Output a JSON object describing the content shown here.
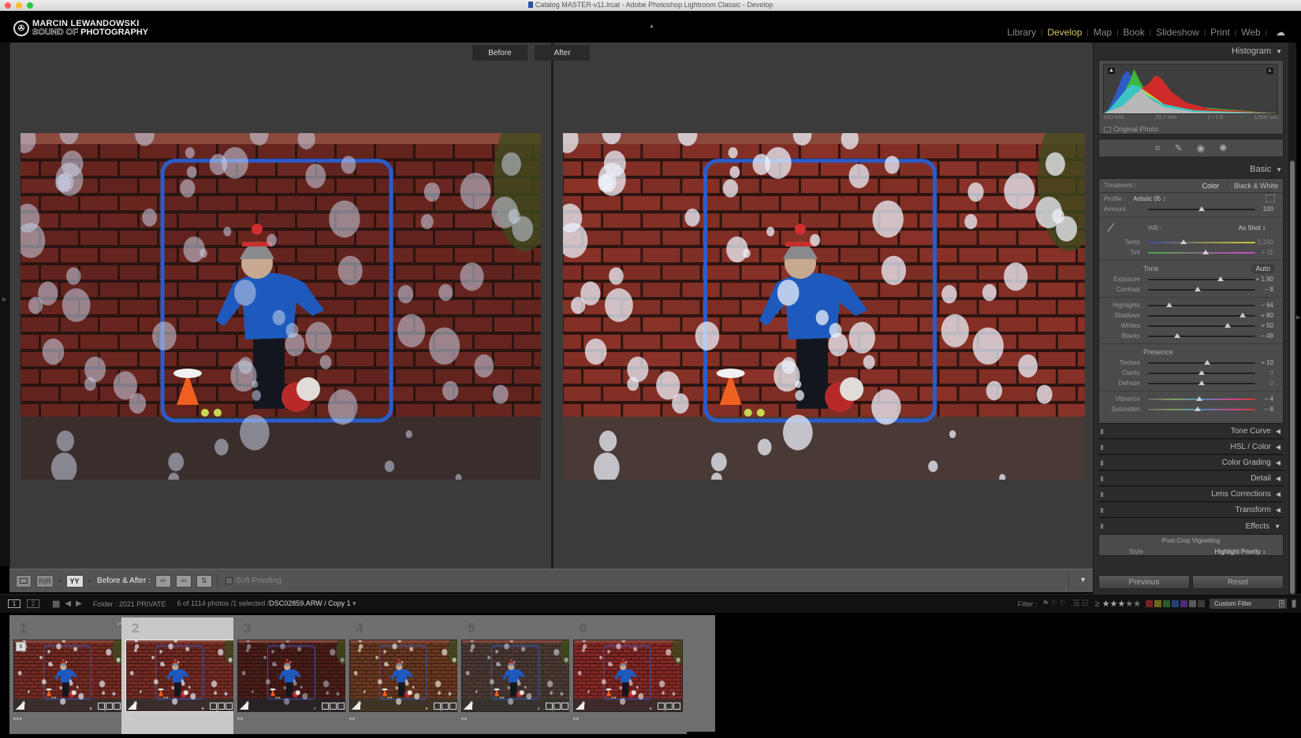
{
  "window": {
    "title": "Catalog MASTER-v11.lrcat - Adobe Photoshop Lightroom Classic - Develop"
  },
  "identity_plate": {
    "line1": "MARCIN LEWANDOWSKI",
    "line2_outline": "SOUND OF",
    "line2_bold": "PHOTOGRAPHY"
  },
  "modules": [
    {
      "label": "Library",
      "active": false
    },
    {
      "label": "Develop",
      "active": true
    },
    {
      "label": "Map",
      "active": false
    },
    {
      "label": "Book",
      "active": false
    },
    {
      "label": "Slideshow",
      "active": false
    },
    {
      "label": "Print",
      "active": false
    },
    {
      "label": "Web",
      "active": false
    }
  ],
  "colors": {
    "active_module": "#d7c56a",
    "panel_bg": "#2b2b2b",
    "section_bg": "#4b4b4b",
    "viewer_bg": "#3b3b3b",
    "filmstrip_bg": "#6e6e6e",
    "filmstrip_selected": "#c8c8c8",
    "brick": "#7a2a22",
    "frame_blue": "#2a5ccc"
  },
  "viewer": {
    "before_label": "Before",
    "after_label": "After",
    "before_tone": "muted",
    "after_tone": "bright"
  },
  "toolbar": {
    "before_after_label": "Before & After :",
    "soft_proofing_label": "Soft Proofing",
    "soft_proofing_checked": false,
    "view_mode_selected": "YY"
  },
  "histogram": {
    "title": "Histogram",
    "iso": "ISO 640",
    "focal_length": "25.7 mm",
    "aperture": "ƒ / 2.8",
    "shutter": "1/500 sec",
    "original_photo_label": "Original Photo"
  },
  "basic": {
    "title": "Basic",
    "treatment_label": "Treatment :",
    "treatment_color": "Color",
    "treatment_bw": "Black & White",
    "profile_label": "Profile :",
    "profile_value": "Artistic 05 ↕",
    "amount_label": "Amount",
    "amount_value": "100",
    "amount_pos": 0.5,
    "wb_label": "WB :",
    "wb_value": "As Shot ↕",
    "temp": {
      "label": "Temp",
      "value": "5,150",
      "pos": 0.33
    },
    "tint": {
      "label": "Tint",
      "value": "+ 11",
      "pos": 0.54
    },
    "tone_label": "Tone",
    "auto_label": "Auto",
    "exposure": {
      "label": "Exposure",
      "value": "+ 1.90",
      "pos": 0.68
    },
    "contrast": {
      "label": "Contrast",
      "value": "– 8",
      "pos": 0.46
    },
    "highlights": {
      "label": "Highlights",
      "value": "– 64",
      "pos": 0.2
    },
    "shadows": {
      "label": "Shadows",
      "value": "+ 80",
      "pos": 0.88
    },
    "whites": {
      "label": "Whites",
      "value": "+ 50",
      "pos": 0.74
    },
    "blacks": {
      "label": "Blacks",
      "value": "– 49",
      "pos": 0.27
    },
    "presence_label": "Presence",
    "texture": {
      "label": "Texture",
      "value": "+ 10",
      "pos": 0.55
    },
    "clarity": {
      "label": "Clarity",
      "value": "0",
      "pos": 0.5
    },
    "dehaze": {
      "label": "Dehaze",
      "value": "0",
      "pos": 0.5
    },
    "vibrance": {
      "label": "Vibrance",
      "value": "– 4",
      "pos": 0.48
    },
    "saturation": {
      "label": "Saturation",
      "value": "– 8",
      "pos": 0.46
    }
  },
  "collapsed_panels": [
    {
      "label": "Tone Curve"
    },
    {
      "label": "HSL / Color"
    },
    {
      "label": "Color Grading"
    },
    {
      "label": "Detail"
    },
    {
      "label": "Lens Corrections"
    },
    {
      "label": "Transform"
    }
  ],
  "effects": {
    "title": "Effects",
    "post_crop_label": "Post-Crop Vignetting",
    "style_label": "Style",
    "style_value": "Highlight Priority ↕"
  },
  "buttons": {
    "previous": "Previous",
    "reset": "Reset"
  },
  "filmstrip_header": {
    "folder": "Folder : 2021 PRIVATE",
    "count": "6 of 1114 photos /1 selected /",
    "filename": "DSC02859.ARW / Copy 1",
    "filter_label": "Filter :",
    "rating_op": "≥",
    "stars_on": 3,
    "stars_total": 5,
    "custom_filter": "Custom Filter",
    "color_labels": [
      "#7a2020",
      "#6e6420",
      "#2a5a2a",
      "#23407a",
      "#4a2a7a",
      "#5a5a5a",
      "#3a3a3a"
    ]
  },
  "filmstrip": [
    {
      "index": "1",
      "stack_count": "6",
      "dots": "▪▪▪",
      "selected": false,
      "tone": "normal"
    },
    {
      "index": "2",
      "dots": "▪▪",
      "selected": true,
      "tone": "normal"
    },
    {
      "index": "3",
      "dots": "▪▪",
      "selected": false,
      "tone": "dark"
    },
    {
      "index": "4",
      "dots": "▪▪",
      "selected": false,
      "tone": "warm"
    },
    {
      "index": "5",
      "dots": "▪▪",
      "selected": false,
      "tone": "faded"
    },
    {
      "index": "6",
      "dots": "▪▪",
      "selected": false,
      "tone": "red"
    }
  ]
}
